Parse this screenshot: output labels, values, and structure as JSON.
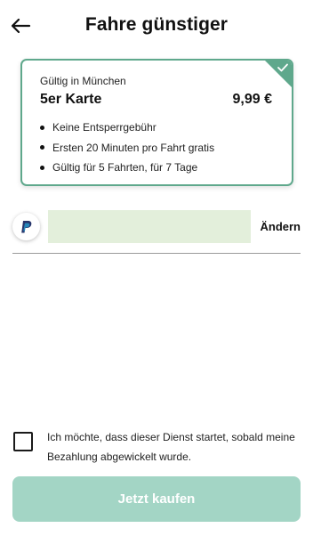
{
  "header": {
    "title": "Fahre günstiger",
    "back_icon": "arrow-left-icon"
  },
  "product_card": {
    "selected": true,
    "validity": "Gültig in München",
    "name": "5er Karte",
    "price": "9,99 €",
    "accent_color": "#5fa88c",
    "features": [
      "Keine Entsperrgebühr",
      "Ersten 20 Minuten pro Fahrt gratis",
      "Gültig für 5 Fahrten, für 7 Tage"
    ]
  },
  "payment": {
    "method_icon": "paypal-icon",
    "field_value": "",
    "change_label": "Ändern"
  },
  "consent": {
    "checked": false,
    "text": "Ich möchte, dass dieser Dienst startet, sobald meine Bezahlung abgewickelt wurde."
  },
  "buy_button": {
    "label": "Jetzt kaufen",
    "enabled": false,
    "color": "#a3d5c5"
  }
}
